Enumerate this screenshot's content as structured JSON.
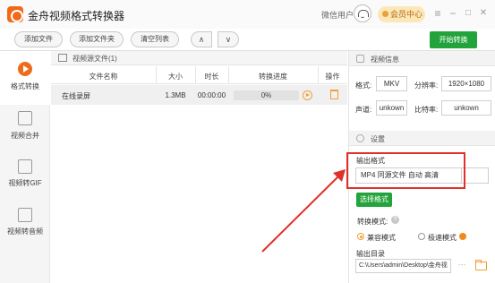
{
  "window": {
    "title": "金舟视频格式转换器",
    "user_label": "微信用户",
    "vip_label": "会员中心",
    "controls": [
      "≡",
      "−",
      "□",
      "✕"
    ]
  },
  "toolbar": {
    "add_file": "添加文件",
    "add_folder": "添加文件夹",
    "clear_list": "清空列表",
    "up": "∧",
    "down": "∨",
    "start": "开始转换"
  },
  "sidebar": {
    "items": [
      {
        "label": "格式转换",
        "icon": "convert-icon",
        "active": true
      },
      {
        "label": "视频合并",
        "icon": "merge-icon",
        "active": false
      },
      {
        "label": "视频转GIF",
        "icon": "gif-icon",
        "active": false
      },
      {
        "label": "视频转音频",
        "icon": "audio-icon",
        "active": false
      }
    ]
  },
  "source": {
    "header": "视频源文件(1)",
    "columns": [
      "文件名称",
      "大小",
      "时长",
      "转换进度",
      "操作"
    ],
    "rows": [
      {
        "name": "在线录屏",
        "size": "1.3MB",
        "duration": "00:00:00",
        "progress": "0%"
      }
    ]
  },
  "info": {
    "header": "视频信息",
    "format_label": "格式:",
    "format_value": "MKV",
    "resolution_label": "分辨率:",
    "resolution_value": "1920×1080",
    "audio_label": "声道:",
    "audio_value": "unkown",
    "bitrate_label": "比特率:",
    "bitrate_value": "unkown"
  },
  "settings": {
    "header": "设置",
    "output_format_label": "输出格式",
    "output_format_value": "MP4 同源文件 自动 高清",
    "choose_format": "选择格式",
    "mode_label": "转换模式:",
    "mode_help": "?",
    "mode_compat": "兼容模式",
    "mode_fast": "极速模式",
    "output_dir_label": "输出目录",
    "output_dir_value": "C:\\Users\\admin\\Desktop\\金舟视",
    "browse": "···"
  },
  "colors": {
    "accent_orange": "#f06a1c",
    "green": "#22a33b",
    "annotation_red": "#e0302a"
  }
}
